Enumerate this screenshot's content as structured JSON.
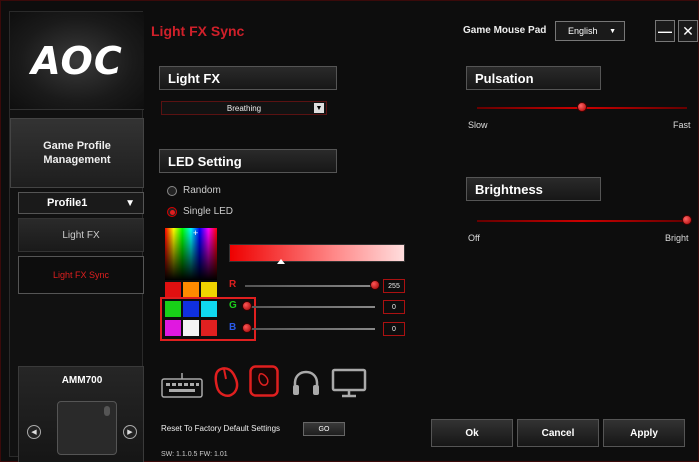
{
  "sidebar": {
    "logo": "AOC",
    "game_profile_line1": "Game Profile",
    "game_profile_line2": "Management",
    "profile_value": "Profile1",
    "menu_lightfx": "Light FX",
    "menu_sync": "Light FX Sync",
    "device_name": "AMM700",
    "prev_glyph": "◀",
    "next_glyph": "▶"
  },
  "header": {
    "title": "Light FX Sync",
    "device_label": "Game Mouse Pad",
    "language": "English",
    "minimize": "—",
    "close": "✕"
  },
  "lightfx": {
    "section": "Light FX",
    "effect": "Breathing"
  },
  "led": {
    "section": "LED Setting",
    "option_random": "Random",
    "option_single": "Single LED",
    "selected": "Single LED",
    "r_label": "R",
    "g_label": "G",
    "b_label": "B",
    "r_value": "255",
    "g_value": "0",
    "b_value": "0"
  },
  "swatches": [
    "#e01010",
    "#ff8a00",
    "#f0d400",
    "#18d018",
    "#1030e0",
    "#10d8f0",
    "#e018e0",
    "#f4f4f4",
    "#e02020"
  ],
  "pulsation": {
    "section": "Pulsation",
    "min_label": "Slow",
    "max_label": "Fast",
    "level": 0.5
  },
  "brightness": {
    "section": "Brightness",
    "min_label": "Off",
    "max_label": "Bright",
    "level": 1.0
  },
  "device_icons": [
    "keyboard-icon",
    "mouse-icon",
    "mousepad-icon",
    "headset-icon",
    "monitor-icon"
  ],
  "footer": {
    "reset_label": "Reset To Factory Default Settings",
    "go_label": "GO",
    "version": "SW: 1.1.0.5  FW: 1.01",
    "ok": "Ok",
    "cancel": "Cancel",
    "apply": "Apply"
  },
  "colors": {
    "accent": "#e01f1f",
    "background": "#0d0d0d"
  }
}
